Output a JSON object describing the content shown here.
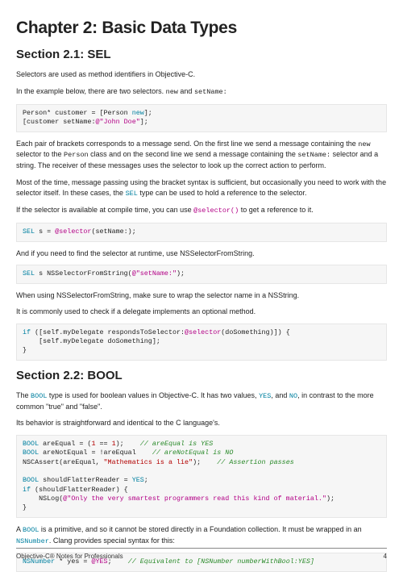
{
  "chapter_title": "Chapter 2: Basic Data Types",
  "section1": {
    "heading": "Section 2.1: SEL",
    "p1": "Selectors are used as method identifiers in Objective-C.",
    "p2_pre": "In the example below, there are two selectors. ",
    "p2_m1": "new",
    "p2_mid": " and ",
    "p2_m2": "setName:",
    "code1_l1a": "Person* customer = [Person ",
    "code1_l1b": "new",
    "code1_l1c": "];",
    "code1_l2a": "[customer setName:",
    "code1_l2b": "@\"John Doe\"",
    "code1_l2c": "];",
    "p3_a": "Each pair of brackets corresponds to a message send. On the first line we send a message containing the ",
    "p3_m1": "new",
    "p3_b": " selector to the ",
    "p3_m2": "Person",
    "p3_c": " class and on the second line we send a message containing the ",
    "p3_m3": "setName:",
    "p3_d": " selector and a string. The receiver of these messages uses the selector to look up the correct action to perform.",
    "p4_a": "Most of the time, message passing using the bracket syntax is sufficient, but occasionally you need to work with the selector itself. In these cases, the ",
    "p4_m1": "SEL",
    "p4_b": " type can be used to hold a reference to the selector.",
    "p5_a": "If the selector is available at compile time, you can use ",
    "p5_m1": "@selector()",
    "p5_b": " to get a reference to it.",
    "code2_a": "SEL",
    "code2_b": " s = ",
    "code2_c": "@selector",
    "code2_d": "(setName:);",
    "p6": "And if you need to find the selector at runtime, use NSSelectorFromString.",
    "code3_a": "SEL",
    "code3_b": " s NSSelectorFromString(",
    "code3_c": "@\"setName:\"",
    "code3_d": ");",
    "p7": "When using NSSelectorFromString, make sure to wrap the selector name in a NSString.",
    "p8": "It is commonly used to check if a delegate implements an optional method.",
    "code4_l1a": "if",
    "code4_l1b": " ([self.myDelegate respondsToSelector:",
    "code4_l1c": "@selector",
    "code4_l1d": "(doSomething)]) {",
    "code4_l2": "    [self.myDelegate doSomething];",
    "code4_l3": "}"
  },
  "section2": {
    "heading": "Section 2.2: BOOL",
    "p1_a": "The ",
    "p1_m1": "BOOL",
    "p1_b": " type is used for boolean values in Objective-C. It has two values, ",
    "p1_m2": "YES",
    "p1_c": ", and ",
    "p1_m3": "NO",
    "p1_d": ", in contrast to the more common \"true\" and \"false\".",
    "p2": "Its behavior is straightforward and identical to the C language's.",
    "c1_l1a": "BOOL",
    "c1_l1b": " areEqual = (",
    "c1_l1c": "1",
    "c1_l1d": " == ",
    "c1_l1e": "1",
    "c1_l1f": ");    ",
    "c1_l1g": "// areEqual is YES",
    "c1_l2a": "BOOL",
    "c1_l2b": " areNotEqual = !areEqual    ",
    "c1_l2c": "// areNotEqual is NO",
    "c1_l3a": "NSCAssert(areEqual, ",
    "c1_l3b": "\"Mathematics is a lie\"",
    "c1_l3c": ");    ",
    "c1_l3d": "// Assertion passes",
    "c1_l4": "",
    "c1_l5a": "BOOL",
    "c1_l5b": " shouldFlatterReader = ",
    "c1_l5c": "YES",
    "c1_l5d": ";",
    "c1_l6a": "if",
    "c1_l6b": " (shouldFlatterReader) {",
    "c1_l7a": "    NSLog(",
    "c1_l7b": "@\"Only the very smartest programmers read this kind of material.\"",
    "c1_l7c": ");",
    "c1_l8": "}",
    "p3_a": "A ",
    "p3_m1": "BOOL",
    "p3_b": " is a primitive, and so it cannot be stored directly in a Foundation collection. It must be wrapped in an ",
    "p3_m2": "NSNumber",
    "p3_c": ". Clang provides special syntax for this:",
    "c2_a": "NSNumber",
    "c2_b": " * yes = ",
    "c2_c": "@YES",
    "c2_d": ";    ",
    "c2_e": "// Equivalent to [NSNumber numberWithBool:YES]"
  },
  "footer": {
    "left": "Objective-C® Notes for Professionals",
    "right": "4"
  }
}
